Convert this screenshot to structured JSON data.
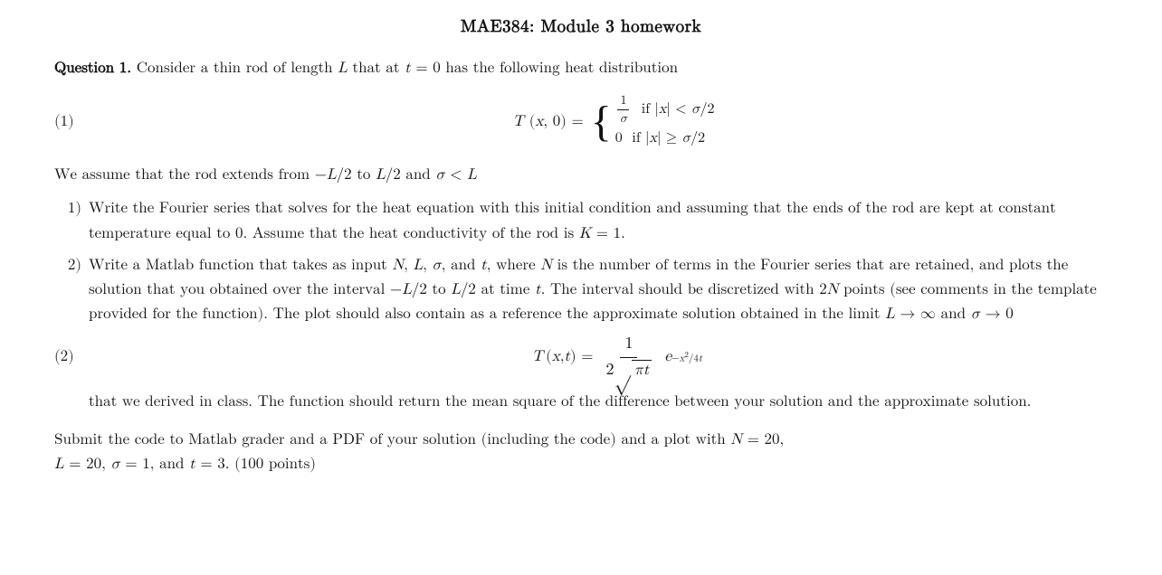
{
  "title": "MAE384: Module 3 homework",
  "question1_label": "Question 1.",
  "question1_intro": "Consider a thin rod of length",
  "question1_mid": "that at",
  "question1_mid2": "= 0 has the following heat distribution",
  "eq1_label": "(1)",
  "assumes": "We assume that the rod extends from −",
  "assumes2": "/2 to",
  "assumes3": "/2 and",
  "assumes4": "< ",
  "item1_num": "1)",
  "item1_text": "Write the Fourier series that solves for the heat equation with this initial condition and assuming that the ends of the rod are kept at constant temperature equal to 0.  Assume that the heat conductivity of the rod is",
  "item1_end": "= 1.",
  "item2_num": "2)",
  "item2_text": "Write a Matlab function that takes as input",
  "item2_vars": ", and",
  "item2_where": "where",
  "item2_N_desc": "is the number of terms in the Fourier series that are retained, and plots the solution that you obtained over the interval −",
  "item2_to": "to",
  "item2_at": "at time",
  "item2_disc": "The interval should be discretized with 2",
  "item2_points": "points (see comments in the template provided for the function).  The plot should also contain as a reference the approximate solution obtained in the limit",
  "item2_limit": "→ ∞ and",
  "item2_limit2": "→ 0",
  "eq2_label": "(2)",
  "item2_derived": "that we derived in class.  The function should return the mean square of the difference between your solution and the approximate solution.",
  "submit_text": "Submit the code to Matlab grader and a PDF of your solution (including the code) and a plot with",
  "submit_N": "= 20,",
  "submit_L": "= 20,",
  "submit_sigma": "= 1, and",
  "submit_t": "= 3.  (100 points)"
}
